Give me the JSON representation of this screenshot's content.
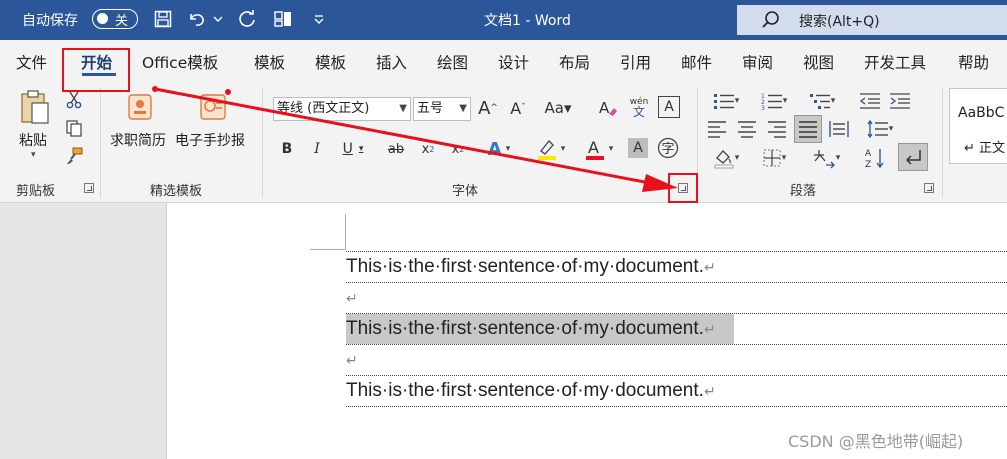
{
  "titlebar": {
    "autosave_label": "自动保存",
    "autosave_state": "关",
    "doc_title": "文档1  -  Word",
    "search_label": "搜索(Alt+Q)",
    "bg_color": "#2b579a"
  },
  "tabs": [
    {
      "label": "文件"
    },
    {
      "label": "开始"
    },
    {
      "label": "Office模板"
    },
    {
      "label": "模板"
    },
    {
      "label": "模板"
    },
    {
      "label": "插入"
    },
    {
      "label": "绘图"
    },
    {
      "label": "设计"
    },
    {
      "label": "布局"
    },
    {
      "label": "引用"
    },
    {
      "label": "邮件"
    },
    {
      "label": "审阅"
    },
    {
      "label": "视图"
    },
    {
      "label": "开发工具"
    },
    {
      "label": "帮助"
    }
  ],
  "ribbon": {
    "clipboard": {
      "paste_label": "粘贴",
      "group_label": "剪贴板"
    },
    "templates": {
      "btn1": "求职简历",
      "btn2": "电子手抄报",
      "group_label": "精选模板"
    },
    "font": {
      "font_name": "等线 (西文正文)",
      "font_size": "五号",
      "group_label": "字体"
    },
    "paragraph": {
      "group_label": "段落"
    },
    "styles": {
      "sample": "AaBbC",
      "sample_name": "↵ 正文"
    }
  },
  "document": {
    "lines": [
      "This·is·the·first·sentence·of·my·document.",
      "",
      "This·is·the·first·sentence·of·my·document.",
      "",
      "This·is·the·first·sentence·of·my·document."
    ],
    "para_mark": "↵"
  },
  "watermark": "CSDN @黑色地带(崛起)"
}
